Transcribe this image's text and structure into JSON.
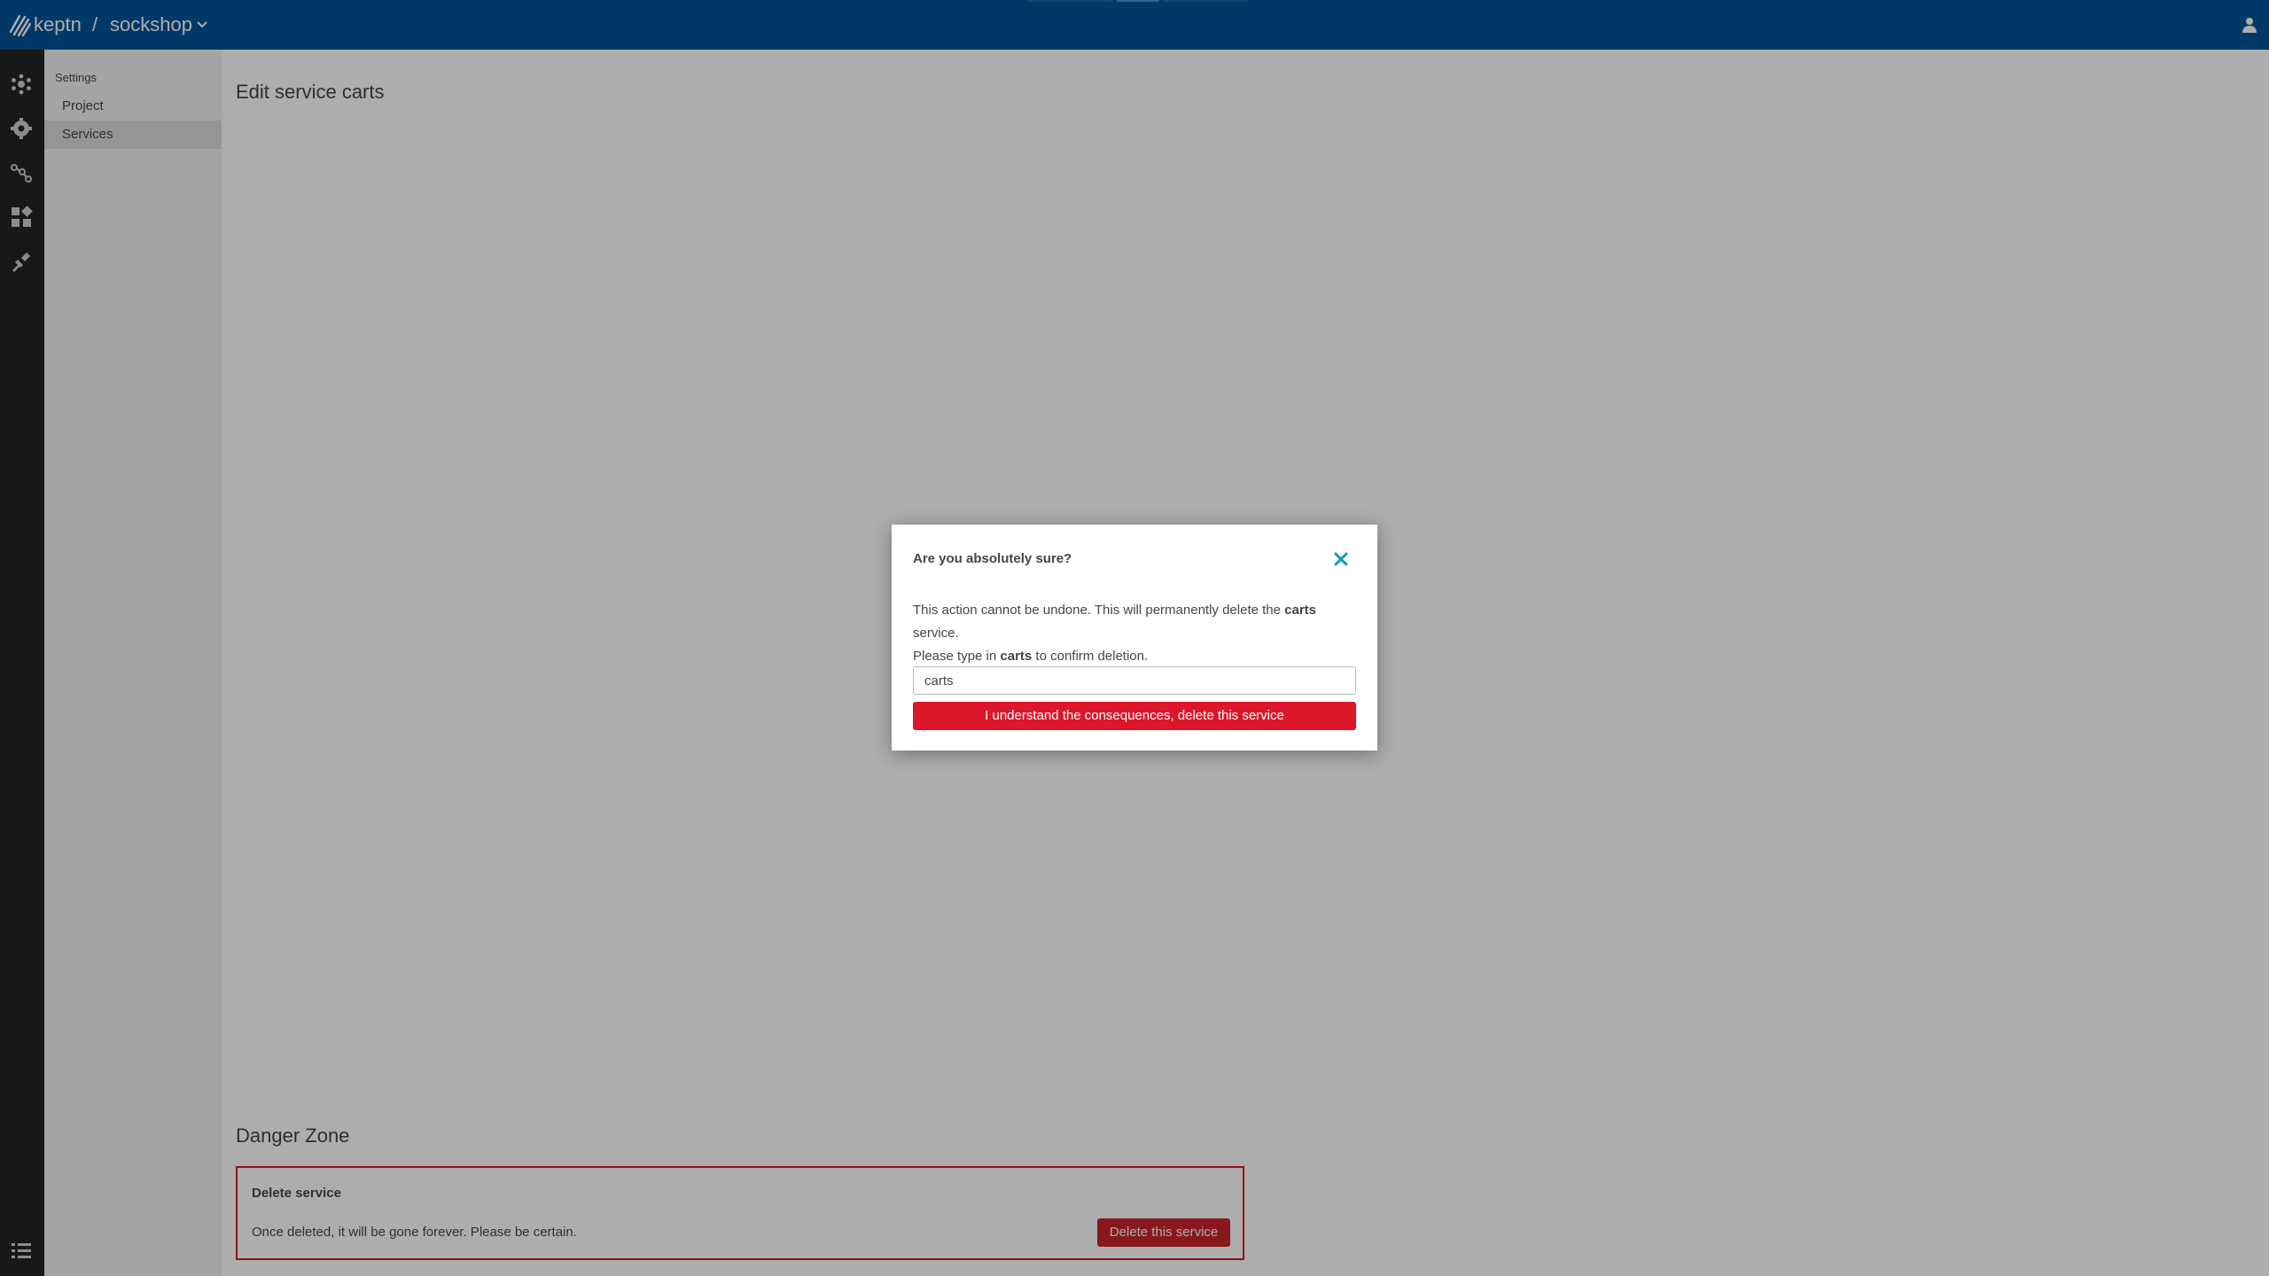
{
  "header": {
    "brand": "keptn",
    "separator": "/",
    "project": "sockshop",
    "bg_color": "#00559a"
  },
  "iconbar": {
    "icons": [
      "environment-icon",
      "settings-icon",
      "sequences-icon",
      "services-icon",
      "integrations-icon"
    ],
    "bottom_icon": "filter-list-icon"
  },
  "sidebar": {
    "title": "Settings",
    "items": [
      {
        "label": "Project",
        "active": false
      },
      {
        "label": "Services",
        "active": true
      }
    ]
  },
  "main": {
    "title": "Edit service carts",
    "danger_zone": {
      "title": "Danger Zone",
      "heading": "Delete service",
      "text": "Once deleted, it will be gone forever. Please be certain.",
      "button": "Delete this service",
      "color": "#dc172a"
    }
  },
  "dialog": {
    "title": "Are you absolutely sure?",
    "msg_a": "This action cannot be undone. This will permanently delete the ",
    "msg_b": "carts",
    "msg_c": " service.",
    "msg_d": "Please type in ",
    "msg_e": "carts",
    "msg_f": " to confirm deletion.",
    "input_value": "carts",
    "confirm_button": "I understand the consequences, delete this service",
    "close_color": "#00a1b2"
  }
}
